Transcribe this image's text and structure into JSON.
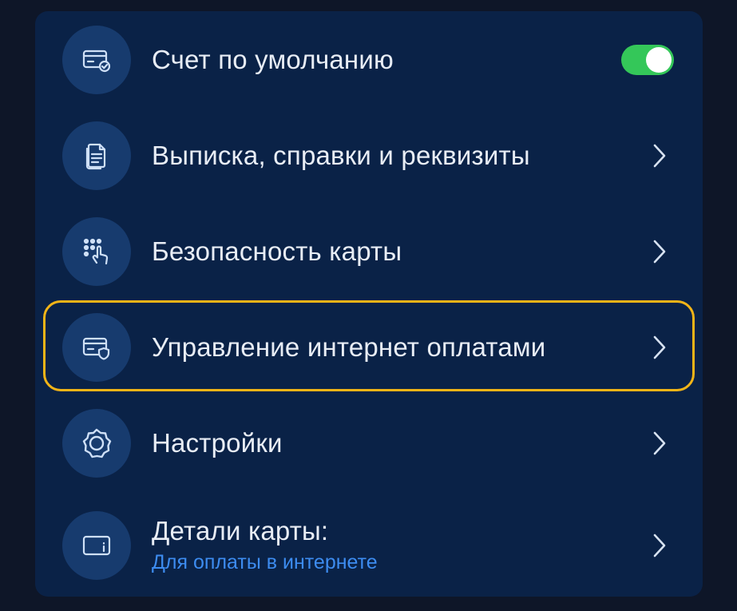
{
  "menu": {
    "items": [
      {
        "label": "Счет по умолчанию",
        "icon": "card-check-icon",
        "control": "toggle",
        "toggle_on": true
      },
      {
        "label": "Выписка, справки и реквизиты",
        "icon": "documents-icon",
        "control": "chevron"
      },
      {
        "label": "Безопасность карты",
        "icon": "keypad-touch-icon",
        "control": "chevron"
      },
      {
        "label": "Управление интернет оплатами",
        "icon": "card-shield-icon",
        "control": "chevron",
        "highlighted": true
      },
      {
        "label": "Настройки",
        "icon": "gear-icon",
        "control": "chevron"
      },
      {
        "label": "Детали карты:",
        "sublabel": "Для оплаты в интернете",
        "icon": "card-info-icon",
        "control": "chevron"
      }
    ]
  },
  "colors": {
    "background": "#0e1628",
    "card": "#0a2247",
    "icon_circle": "#173b6e",
    "text": "#e8edf5",
    "accent_link": "#3d8cf0",
    "toggle_on": "#34c759",
    "highlight_border": "#f2b417"
  }
}
